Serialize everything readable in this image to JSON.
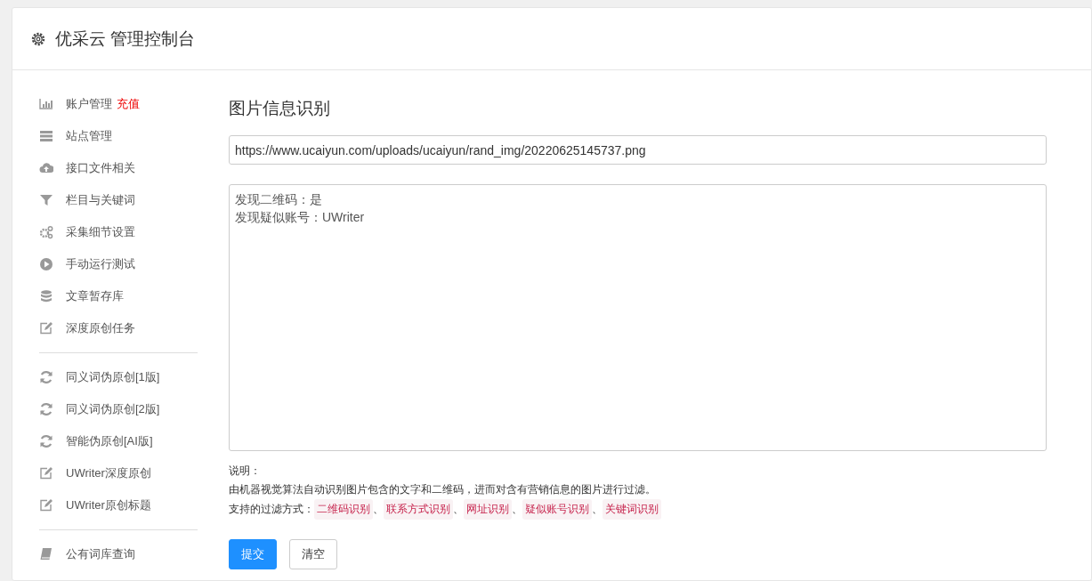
{
  "header": {
    "title": "优采云 管理控制台"
  },
  "sidebar": {
    "groups": [
      {
        "items": [
          {
            "label": "账户管理",
            "badge": "充值"
          },
          {
            "label": "站点管理"
          },
          {
            "label": "接口文件相关"
          },
          {
            "label": "栏目与关键词"
          },
          {
            "label": "采集细节设置"
          },
          {
            "label": "手动运行测试"
          },
          {
            "label": "文章暂存库"
          },
          {
            "label": "深度原创任务"
          }
        ]
      },
      {
        "items": [
          {
            "label": "同义词伪原创[1版]"
          },
          {
            "label": "同义词伪原创[2版]"
          },
          {
            "label": "智能伪原创[AI版]"
          },
          {
            "label": "UWriter深度原创"
          },
          {
            "label": "UWriter原创标题"
          }
        ]
      },
      {
        "items": [
          {
            "label": "公有词库查询"
          }
        ]
      }
    ]
  },
  "main": {
    "heading": "图片信息识别",
    "url_field": {
      "value": "https://www.ucaiyun.com/uploads/ucaiyun/rand_img/20220625145737.png"
    },
    "result_lines": [
      "发现二维码：是",
      "发现疑似账号：UWriter"
    ],
    "note_title": "说明：",
    "note_text": "由机器视觉算法自动识别图片包含的文字和二维码，进而对含有营销信息的图片进行过滤。",
    "methods_label": "支持的过滤方式：",
    "methods": [
      "二维码识别",
      "联系方式识别",
      "网址识别",
      "疑似账号识别",
      "关键词识别"
    ],
    "separator": "、",
    "buttons": [
      {
        "label": "提交",
        "kind": "primary"
      },
      {
        "label": "清空",
        "kind": "default"
      }
    ]
  }
}
